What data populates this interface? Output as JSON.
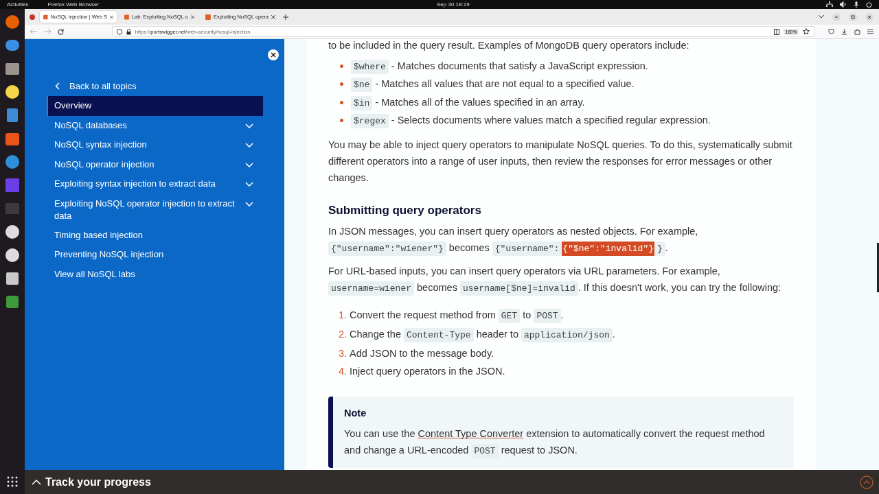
{
  "topbar": {
    "activities": "Activities",
    "app": "Firefox Web Browser",
    "clock": "Sep 30  18:19"
  },
  "browser": {
    "tabs": [
      {
        "title": "NoSQL injection | Web S",
        "selected": true
      },
      {
        "title": "Lab: Exploiting NoSQL o",
        "selected": false
      },
      {
        "title": "Exploiting NoSQL opera",
        "selected": false
      }
    ],
    "url_scheme": "https://",
    "url_host": "portswigger.net",
    "url_path": "/web-security/nosql-injection",
    "zoom": "160%"
  },
  "sidebar": {
    "back": "Back to all topics",
    "items": [
      {
        "label": "Overview",
        "selected": true,
        "expandable": false
      },
      {
        "label": "NoSQL databases",
        "selected": false,
        "expandable": true
      },
      {
        "label": "NoSQL syntax injection",
        "selected": false,
        "expandable": true
      },
      {
        "label": "NoSQL operator injection",
        "selected": false,
        "expandable": true
      },
      {
        "label": "Exploiting syntax injection to extract data",
        "selected": false,
        "expandable": true
      },
      {
        "label": "Exploiting NoSQL operator injection to extract data",
        "selected": false,
        "expandable": true
      },
      {
        "label": "Timing based injection",
        "selected": false,
        "expandable": false
      },
      {
        "label": "Preventing NoSQL injection",
        "selected": false,
        "expandable": false
      },
      {
        "label": "View all NoSQL labs",
        "selected": false,
        "expandable": false
      }
    ]
  },
  "article": {
    "intro": "to be included in the query result. Examples of MongoDB query operators include:",
    "operators": [
      {
        "code": "$where",
        "text": " - Matches documents that satisfy a JavaScript expression."
      },
      {
        "code": "$ne",
        "text": " - Matches all values that are not equal to a specified value."
      },
      {
        "code": "$in",
        "text": " - Matches all of the values specified in an array."
      },
      {
        "code": "$regex",
        "text": " - Selects documents where values match a specified regular expression."
      }
    ],
    "paragraph": "You may be able to inject query operators to manipulate NoSQL queries. To do this, systematically submit different operators into a range of user inputs, then review the responses for error messages or other changes.",
    "heading": "Submitting query operators",
    "paragraphs": [
      [
        {
          "kind": "text",
          "text": "In JSON messages, you can insert query operators as nested objects. For example, "
        },
        {
          "kind": "code",
          "text": "{\"username\":\"wiener\"}"
        },
        {
          "kind": "text",
          "text": " becomes "
        },
        {
          "kind": "code",
          "text": "{\"username\":"
        },
        {
          "kind": "code_selected",
          "text": "{\"$ne\":\"invalid\"}"
        },
        {
          "kind": "code",
          "text": "}"
        },
        {
          "kind": "text",
          "text": "."
        }
      ],
      [
        {
          "kind": "text",
          "text": "For URL-based inputs, you can insert query operators via URL parameters. For example, "
        },
        {
          "kind": "code",
          "text": "username=wiener"
        },
        {
          "kind": "text",
          "text": " becomes "
        },
        {
          "kind": "code",
          "text": "username[$ne]=invalid"
        },
        {
          "kind": "text",
          "text": ". If this doesn't work, you can try the following:"
        }
      ]
    ],
    "steps": [
      {
        "number": "1.",
        "parts": [
          {
            "kind": "text",
            "text": "Convert the request method from "
          },
          {
            "kind": "code",
            "text": "GET"
          },
          {
            "kind": "text",
            "text": " to "
          },
          {
            "kind": "code",
            "text": "POST"
          },
          {
            "kind": "text",
            "text": "."
          }
        ]
      },
      {
        "number": "2.",
        "parts": [
          {
            "kind": "text",
            "text": "Change the "
          },
          {
            "kind": "code",
            "text": "Content-Type"
          },
          {
            "kind": "text",
            "text": " header to "
          },
          {
            "kind": "code",
            "text": "application/json"
          },
          {
            "kind": "text",
            "text": "."
          }
        ]
      },
      {
        "number": "3.",
        "parts": [
          {
            "kind": "text",
            "text": "Add JSON to the message body."
          }
        ]
      },
      {
        "number": "4.",
        "parts": [
          {
            "kind": "text",
            "text": "Inject query operators in the JSON."
          }
        ]
      }
    ],
    "note": {
      "title": "Note",
      "parts": [
        {
          "kind": "text",
          "text": "You can use the "
        },
        {
          "kind": "link",
          "text": "Content Type Converter"
        },
        {
          "kind": "text",
          "text": " extension to automatically convert the request method and change a URL-encoded "
        },
        {
          "kind": "code",
          "text": "POST"
        },
        {
          "kind": "text",
          "text": " request to JSON."
        }
      ]
    }
  },
  "footer": {
    "label": "Track your progress"
  }
}
